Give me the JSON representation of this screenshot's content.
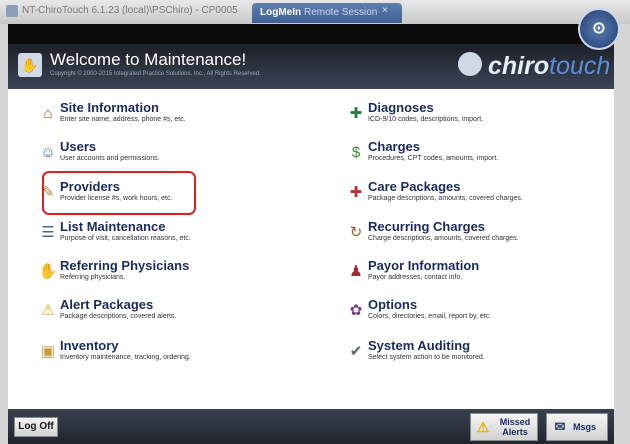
{
  "window": {
    "title": "NT-ChiroTouch 6.1.23 (local)\\PSChiro) - CP0005",
    "remote_tab_app": "LogMeIn",
    "remote_tab_label": "Remote Session",
    "close_glyph": "×"
  },
  "header": {
    "welcome": "Welcome to Maintenance!",
    "copyright": "Copyright © 2000-2015 Integrated Practice Solutions, Inc., All Rights Reserved.",
    "logo_part1": "chiro",
    "logo_part2": "touch"
  },
  "menu": {
    "left": [
      {
        "label": "Site Information",
        "desc": "Enter site name, address, phone #s, etc.",
        "icon": "house-icon"
      },
      {
        "label": "Users",
        "desc": "User accounts and permissions.",
        "icon": "users-icon"
      },
      {
        "label": "Providers",
        "desc": "Provider license #s, work hours, etc.",
        "icon": "document-icon"
      },
      {
        "label": "List Maintenance",
        "desc": "Purpose of visit, cancellation reasons, etc.",
        "icon": "list-icon"
      },
      {
        "label": "Referring Physicians",
        "desc": "Referring physicians.",
        "icon": "handshake-icon"
      },
      {
        "label": "Alert Packages",
        "desc": "Package descriptions, covered alerts.",
        "icon": "warning-icon"
      },
      {
        "label": "Inventory",
        "desc": "Inventory maintenance, tracking, ordering.",
        "icon": "box-icon"
      }
    ],
    "right": [
      {
        "label": "Diagnoses",
        "desc": "ICD-9/10 codes, descriptions, import.",
        "icon": "diagnosis-icon"
      },
      {
        "label": "Charges",
        "desc": "Procedures, CPT codes, amounts, import.",
        "icon": "money-icon"
      },
      {
        "label": "Care Packages",
        "desc": "Package descriptions, amounts, covered charges.",
        "icon": "package-icon"
      },
      {
        "label": "Recurring Charges",
        "desc": "Charge descriptions, amounts, covered charges.",
        "icon": "recurring-icon"
      },
      {
        "label": "Payor Information",
        "desc": "Payor addresses, contact info.",
        "icon": "payor-icon"
      },
      {
        "label": "Options",
        "desc": "Colors, directories, email, report by, etc.",
        "icon": "options-icon"
      },
      {
        "label": "System Auditing",
        "desc": "Select system action to be monitored.",
        "icon": "audit-icon"
      }
    ]
  },
  "footer": {
    "logoff": "Log Off",
    "missed_alerts": "Missed Alerts",
    "msgs": "Msgs"
  }
}
